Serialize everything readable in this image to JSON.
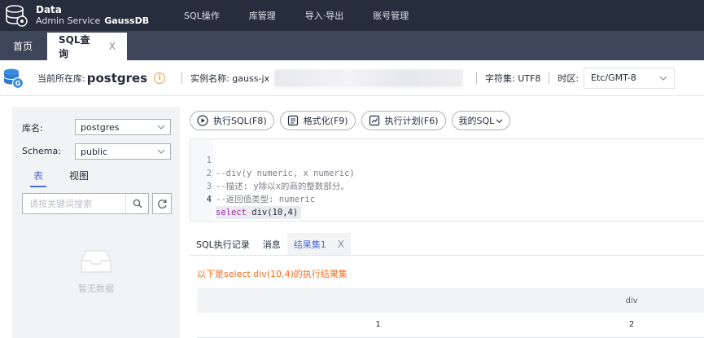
{
  "app": {
    "brand_line1": "Data",
    "brand_line2": "Admin Service",
    "brand_product": "GaussDB"
  },
  "nav": {
    "items": [
      "SQL操作",
      "库管理",
      "导入·导出",
      "账号管理"
    ]
  },
  "tabs": {
    "home": "首页",
    "active": "SQL查询",
    "close": "X"
  },
  "infobar": {
    "current_db_label": "当前所在库:",
    "current_db": "postgres",
    "instance_label": "实例名称: gauss-jx",
    "charset_label": "字符集: UTF8",
    "timezone_label": "时区:",
    "timezone_value": "Etc/GMT-8"
  },
  "sidebar": {
    "db_label": "库名:",
    "db_value": "postgres",
    "schema_label": "Schema:",
    "schema_value": "public",
    "tab_table": "表",
    "tab_view": "视图",
    "search_placeholder": "请按关键词搜索",
    "empty_text": "暂无数据"
  },
  "toolbar": {
    "execute": "执行SQL(F8)",
    "format": "格式化(F9)",
    "plan": "执行计划(F6)",
    "my_sql": "我的SQL"
  },
  "editor": {
    "lines": [
      {
        "num": "1",
        "text": "--div(y numeric, x numeric)"
      },
      {
        "num": "2",
        "text": "--描述: y除以x的商的整数部分。"
      },
      {
        "num": "3",
        "text": "--返回值类型: numeric"
      },
      {
        "num": "4",
        "kw": "select",
        "rest": " div(10,4)"
      }
    ]
  },
  "results": {
    "tab_history": "SQL执行记录",
    "tab_messages": "消息",
    "tab_result": "结果集1",
    "tab_close": "X",
    "caption": "以下是select div(10,4)的执行结果集",
    "columns": [
      "",
      "div"
    ],
    "rows": [
      [
        "1",
        "2"
      ]
    ]
  },
  "colors": {
    "nav_bg": "#262d3d",
    "tab_bg": "#3d4559",
    "accent": "#526ecc",
    "caption": "#fa6b1e"
  }
}
